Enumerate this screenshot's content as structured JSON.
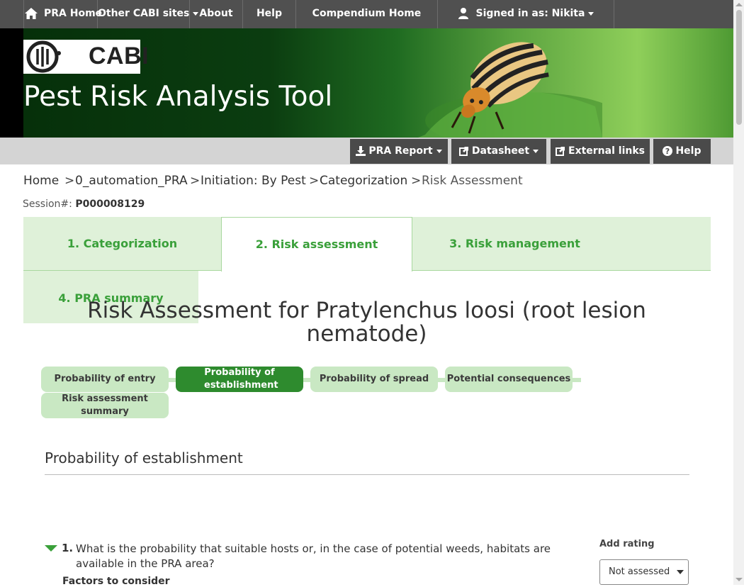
{
  "topnav": {
    "home": "PRA Home",
    "other_sites": "Other CABI sites",
    "about": "About",
    "help": "Help",
    "compendium": "Compendium Home",
    "signed_in": "Signed in as: Nikita"
  },
  "banner": {
    "logo_text": "CABI",
    "title": "Pest Risk Analysis Tool"
  },
  "actions": {
    "pra_report": "PRA Report",
    "datasheet": "Datasheet",
    "external_links": "External links",
    "help": "Help"
  },
  "breadcrumb": {
    "items": [
      "Home",
      "0_automation_PRA",
      "Initiation: By Pest",
      "Categorization",
      "Risk Assessment"
    ],
    "separator": ">"
  },
  "session": {
    "label": "Session#:",
    "value": "P000008129"
  },
  "tabs": [
    {
      "label": "1. Categorization"
    },
    {
      "label": "2. Risk assessment"
    },
    {
      "label": "3. Risk management"
    },
    {
      "label": "4. PRA summary"
    }
  ],
  "page_title": "Risk Assessment for Pratylenchus loosi (root lesion nematode)",
  "pills": [
    {
      "label": "Probability of entry"
    },
    {
      "label": "Probability of establishment"
    },
    {
      "label": "Probability of spread"
    },
    {
      "label": "Potential consequences"
    },
    {
      "label": "Risk assessment summary"
    }
  ],
  "section": {
    "title": "Probability of establishment",
    "question_number": "1.",
    "question_text": "What is the probability that suitable hosts or, in the case of potential weeds, habitats are available in the PRA area?",
    "factors_label": "Factors to consider",
    "rating_label": "Add rating",
    "rating_value": "Not assessed"
  },
  "colors": {
    "topnav_bg": "#505050",
    "accent_green": "#3aa03a",
    "tab_bg": "#dff1d9",
    "pill_bg": "#c9e8c3",
    "pill_active_bg": "#2e8b2e"
  }
}
